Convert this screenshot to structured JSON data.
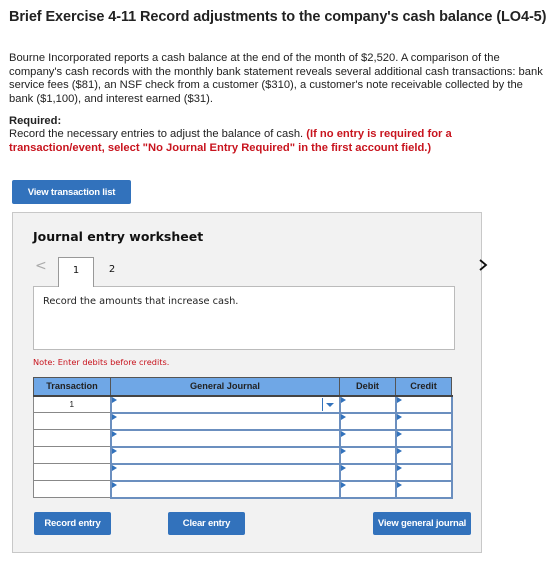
{
  "header": {
    "title": "Brief Exercise 4-11 Record adjustments to the company's cash balance (LO4-5)"
  },
  "problem": {
    "text": "Bourne Incorporated reports a cash balance at the end of the month of $2,520. A comparison of the company's cash records with the monthly bank statement reveals several additional cash transactions: bank service fees ($81), an NSF check from a customer ($310), a customer's note receivable collected by the bank ($1,100), and interest earned ($31)."
  },
  "required": {
    "label": "Required:",
    "text": "Record the necessary entries to adjust the balance of cash. ",
    "emphasis": "(If no entry is required for a transaction/event, select \"No Journal Entry Required\" in the first account field.)"
  },
  "buttons": {
    "view_transaction_list": "View transaction list",
    "record_entry": "Record entry",
    "clear_entry": "Clear entry",
    "view_general_journal": "View general journal"
  },
  "worksheet": {
    "title": "Journal entry worksheet",
    "nav_prev": "<",
    "nav_next": ">",
    "tabs": [
      {
        "label": "1",
        "active": true
      },
      {
        "label": "2",
        "active": false
      }
    ],
    "instruction": "Record the amounts that increase cash.",
    "note": "Note: Enter debits before credits."
  },
  "journal": {
    "headers": [
      "Transaction",
      "General Journal",
      "Debit",
      "Credit"
    ],
    "rows": [
      {
        "transaction": "1",
        "account": "",
        "debit": "",
        "credit": ""
      },
      {
        "transaction": "",
        "account": "",
        "debit": "",
        "credit": ""
      },
      {
        "transaction": "",
        "account": "",
        "debit": "",
        "credit": ""
      },
      {
        "transaction": "",
        "account": "",
        "debit": "",
        "credit": ""
      },
      {
        "transaction": "",
        "account": "",
        "debit": "",
        "credit": ""
      },
      {
        "transaction": "",
        "account": "",
        "debit": "",
        "credit": ""
      }
    ]
  },
  "colors": {
    "accent": "#3272bc",
    "header_fill": "#6fa7e6",
    "alert": "#c8141e",
    "panel_bg": "#f2f2f2"
  }
}
